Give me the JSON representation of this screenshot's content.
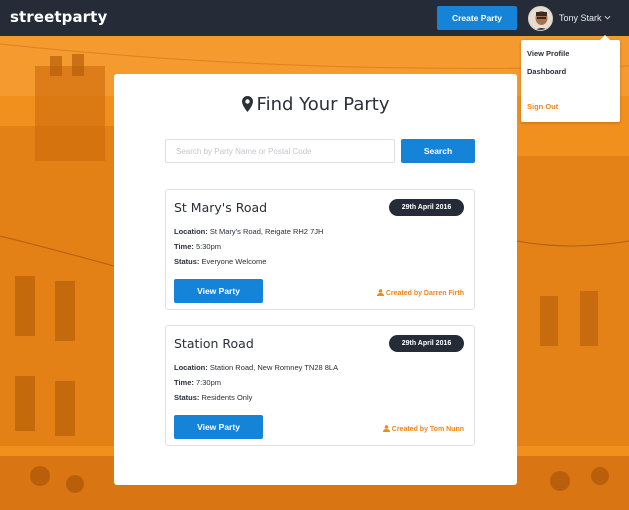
{
  "navbar": {
    "brand": "streetparty",
    "create_label": "Create Party",
    "user_name": "Tony Stark"
  },
  "dropdown": {
    "items": [
      "View Profile",
      "Dashboard",
      "Sign Out"
    ]
  },
  "main": {
    "title": "Find Your Party",
    "search_placeholder": "Search by Party Name or Postal Code",
    "search_label": "Search"
  },
  "parties": [
    {
      "name": "St Mary's Road",
      "date": "29th April 2016",
      "location_label": "Location:",
      "location": "St Mary's Road, Reigate RH2 7JH",
      "time_label": "Time:",
      "time": "5:30pm",
      "status_label": "Status:",
      "status": "Everyone Welcome",
      "view_label": "View Party",
      "created_by": "Created by Darren Firth"
    },
    {
      "name": "Station Road",
      "date": "29th April 2016",
      "location_label": "Location:",
      "location": "Station Road, New Romney TN28 8LA",
      "time_label": "Time:",
      "time": "7:30pm",
      "status_label": "Status:",
      "status": "Residents Only",
      "view_label": "View Party",
      "created_by": "Created by Tom Nunn"
    }
  ],
  "colors": {
    "navbar": "#252c37",
    "accent": "#1583d8",
    "orange": "#f08d1c",
    "badge": "#252c37"
  },
  "icons": {
    "title": "map-pin-icon",
    "created_by": "user-icon",
    "menu": "chevron-down-icon"
  }
}
